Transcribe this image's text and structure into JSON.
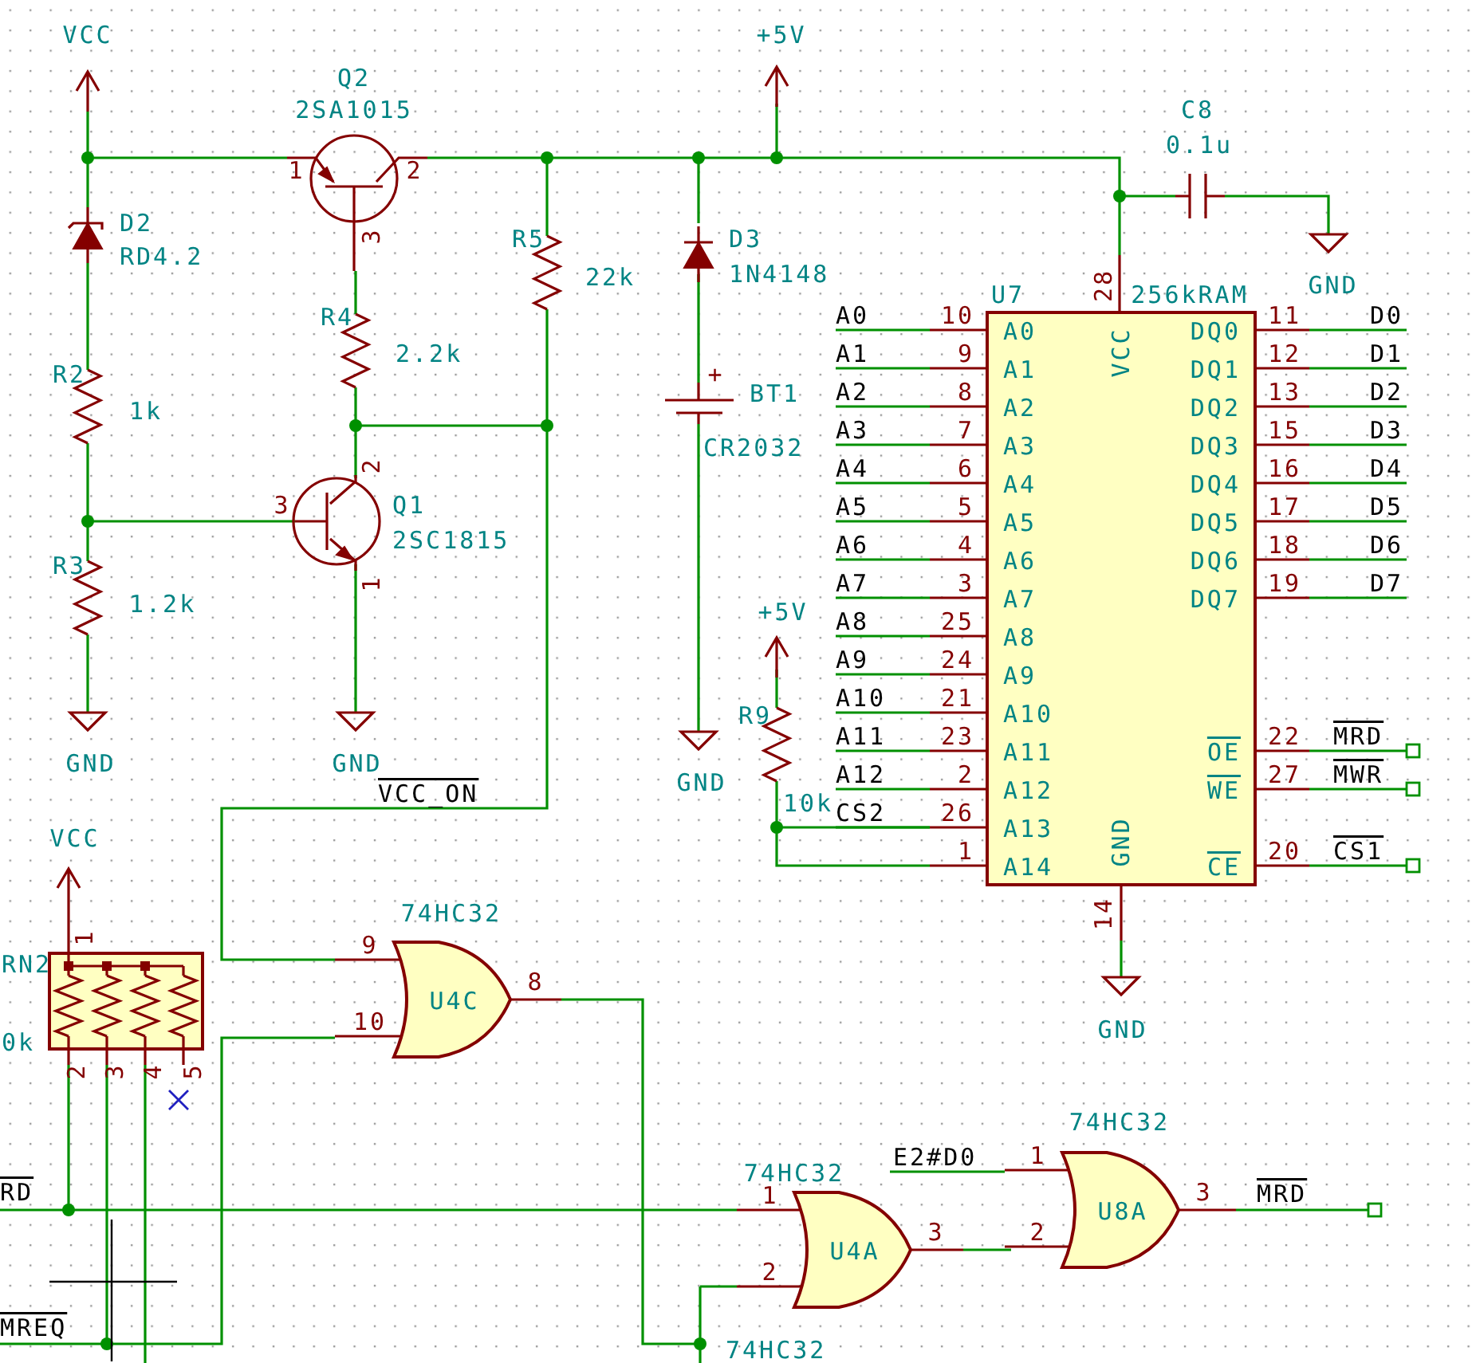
{
  "power_ports": [
    {
      "kind": "supply",
      "label": "VCC"
    },
    {
      "kind": "supply",
      "label": "+5V"
    },
    {
      "kind": "ground",
      "label": "GND"
    },
    {
      "kind": "ground",
      "label": "GND"
    },
    {
      "kind": "ground",
      "label": "GND"
    },
    {
      "kind": "ground",
      "label": "GND"
    },
    {
      "kind": "supply",
      "label": "+5V"
    },
    {
      "kind": "ground",
      "label": "GND"
    },
    {
      "kind": "supply",
      "label": "VCC"
    }
  ],
  "transistors": [
    {
      "kind": "pnp",
      "ref": "Q2",
      "value": "2SA1015",
      "pins": [
        "1",
        "2",
        "3"
      ]
    },
    {
      "kind": "npn",
      "ref": "Q1",
      "value": "2SC1815",
      "pins": [
        "3",
        "2",
        "1"
      ]
    }
  ],
  "diodes": [
    {
      "kind": "zener",
      "ref": "D2",
      "value": "RD4.2"
    },
    {
      "kind": "rectifier",
      "ref": "D3",
      "value": "1N4148"
    }
  ],
  "resistors": [
    {
      "ref": "R5",
      "value": "22k"
    },
    {
      "ref": "R4",
      "value": "2.2k"
    },
    {
      "ref": "R2",
      "value": "1k"
    },
    {
      "ref": "R3",
      "value": "1.2k"
    },
    {
      "ref": "R9",
      "value": "10k"
    }
  ],
  "battery": {
    "ref": "BT1",
    "value": "CR2032",
    "polarity": "+"
  },
  "capacitor": {
    "ref": "C8",
    "value": "0.1u"
  },
  "ram": {
    "ref": "U7",
    "value": "256kRAM",
    "power_pins": [
      {
        "name": "VCC",
        "number": "28"
      },
      {
        "name": "GND",
        "number": "14"
      }
    ],
    "left_pins": [
      {
        "number": "10",
        "name": "A0",
        "net": "A0"
      },
      {
        "number": "9",
        "name": "A1",
        "net": "A1"
      },
      {
        "number": "8",
        "name": "A2",
        "net": "A2"
      },
      {
        "number": "7",
        "name": "A3",
        "net": "A3"
      },
      {
        "number": "6",
        "name": "A4",
        "net": "A4"
      },
      {
        "number": "5",
        "name": "A5",
        "net": "A5"
      },
      {
        "number": "4",
        "name": "A6",
        "net": "A6"
      },
      {
        "number": "3",
        "name": "A7",
        "net": "A7"
      },
      {
        "number": "25",
        "name": "A8",
        "net": "A8"
      },
      {
        "number": "24",
        "name": "A9",
        "net": "A9"
      },
      {
        "number": "21",
        "name": "A10",
        "net": "A10"
      },
      {
        "number": "23",
        "name": "A11",
        "net": "A11"
      },
      {
        "number": "2",
        "name": "A12",
        "net": "A12"
      },
      {
        "number": "26",
        "name": "A13",
        "net": "CS2"
      },
      {
        "number": "1",
        "name": "A14"
      }
    ],
    "right_pins": [
      {
        "number": "11",
        "name": "DQ0",
        "name_inverted": false,
        "net": {
          "kind": "local",
          "text": "D0",
          "inverted": false
        }
      },
      {
        "number": "12",
        "name": "DQ1",
        "name_inverted": false,
        "net": {
          "kind": "local",
          "text": "D1",
          "inverted": false
        }
      },
      {
        "number": "13",
        "name": "DQ2",
        "name_inverted": false,
        "net": {
          "kind": "local",
          "text": "D2",
          "inverted": false
        }
      },
      {
        "number": "15",
        "name": "DQ3",
        "name_inverted": false,
        "net": {
          "kind": "local",
          "text": "D3",
          "inverted": false
        }
      },
      {
        "number": "16",
        "name": "DQ4",
        "name_inverted": false,
        "net": {
          "kind": "local",
          "text": "D4",
          "inverted": false
        }
      },
      {
        "number": "17",
        "name": "DQ5",
        "name_inverted": false,
        "net": {
          "kind": "local",
          "text": "D5",
          "inverted": false
        }
      },
      {
        "number": "18",
        "name": "DQ6",
        "name_inverted": false,
        "net": {
          "kind": "local",
          "text": "D6",
          "inverted": false
        }
      },
      {
        "number": "19",
        "name": "DQ7",
        "name_inverted": false,
        "net": {
          "kind": "local",
          "text": "D7",
          "inverted": false
        }
      },
      {
        "number": "22",
        "name": "OE",
        "name_inverted": true,
        "net": {
          "kind": "global",
          "text": "MRD",
          "inverted": true
        }
      },
      {
        "number": "27",
        "name": "WE",
        "name_inverted": true,
        "net": {
          "kind": "global",
          "text": "MWR",
          "inverted": true
        }
      },
      {
        "number": "20",
        "name": "CE",
        "name_inverted": true,
        "net": {
          "kind": "global",
          "text": "CS1",
          "inverted": true
        }
      }
    ]
  },
  "resistor_network": {
    "ref": "RN2",
    "value": "0k",
    "pins": [
      {
        "number": "1",
        "no_connect": false
      },
      {
        "number": "2",
        "no_connect": false
      },
      {
        "number": "3",
        "no_connect": false
      },
      {
        "number": "4",
        "no_connect": false
      },
      {
        "number": "5",
        "no_connect": true
      }
    ]
  },
  "gates": [
    {
      "part": "74HC32",
      "ref": "U4C",
      "inputs": [
        "9",
        "10"
      ],
      "output": "8"
    },
    {
      "part": "74HC32",
      "ref": "U4A",
      "inputs": [
        "1",
        "2"
      ],
      "output": "3"
    },
    {
      "part": "74HC32",
      "ref": "U8A",
      "inputs": [
        "1",
        "2"
      ],
      "output": "3"
    }
  ],
  "net_labels": [
    {
      "kind": "local",
      "text": "VCC_ON",
      "inverted": true
    },
    {
      "kind": "local",
      "text": "RD",
      "inverted": true
    },
    {
      "kind": "local",
      "text": "MREQ",
      "inverted": true
    },
    {
      "kind": "local",
      "text": "E2#D0",
      "inverted": false
    },
    {
      "kind": "global",
      "text": "MRD",
      "inverted": true
    }
  ],
  "cut_labels": [
    "74HC32"
  ]
}
